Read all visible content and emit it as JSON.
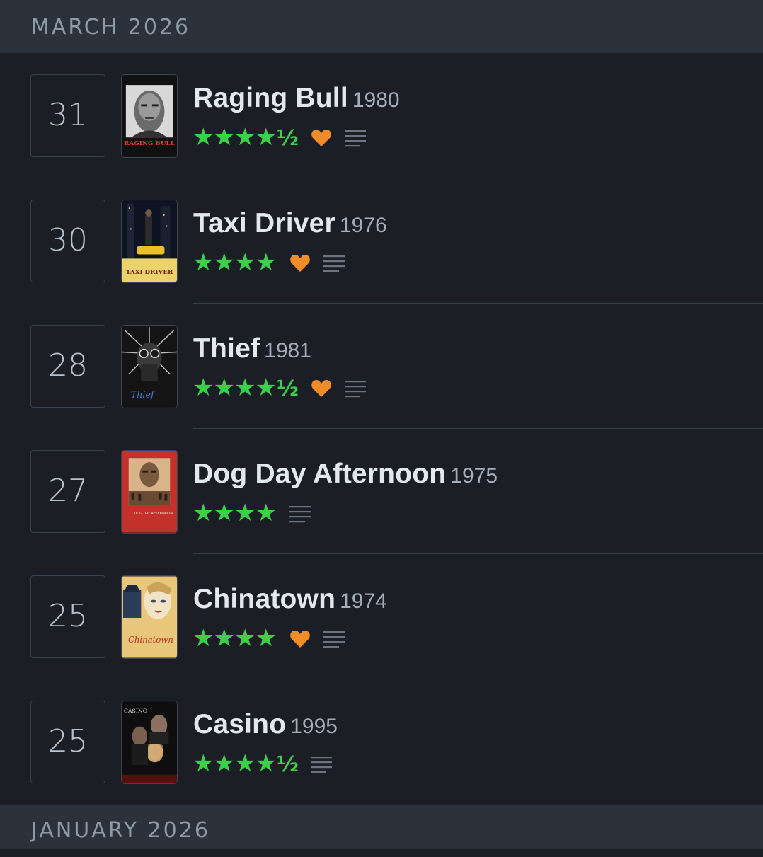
{
  "months": {
    "current": "MARCH 2026",
    "next": "JANUARY 2026"
  },
  "colors": {
    "background": "#1b1f25",
    "header": "#2b323b",
    "star_green": "#3ccf4a",
    "heart_orange": "#f28c28"
  },
  "entries": [
    {
      "day": "31",
      "title": "Raging Bull",
      "year": "1980",
      "stars": "★★★★",
      "half": "½",
      "rating": 4.5,
      "liked": true,
      "has_review": true,
      "poster_icon": "raging-bull-poster"
    },
    {
      "day": "30",
      "title": "Taxi Driver",
      "year": "1976",
      "stars": "★★★★",
      "half": "",
      "rating": 4,
      "liked": true,
      "has_review": true,
      "poster_icon": "taxi-driver-poster"
    },
    {
      "day": "28",
      "title": "Thief",
      "year": "1981",
      "stars": "★★★★",
      "half": "½",
      "rating": 4.5,
      "liked": true,
      "has_review": true,
      "poster_icon": "thief-poster"
    },
    {
      "day": "27",
      "title": "Dog Day Afternoon",
      "year": "1975",
      "stars": "★★★★",
      "half": "",
      "rating": 4,
      "liked": false,
      "has_review": true,
      "poster_icon": "dog-day-afternoon-poster"
    },
    {
      "day": "25",
      "title": "Chinatown",
      "year": "1974",
      "stars": "★★★★",
      "half": "",
      "rating": 4,
      "liked": true,
      "has_review": true,
      "poster_icon": "chinatown-poster"
    },
    {
      "day": "25",
      "title": "Casino",
      "year": "1995",
      "stars": "★★★★",
      "half": "½",
      "rating": 4.5,
      "liked": false,
      "has_review": true,
      "poster_icon": "casino-poster"
    }
  ],
  "poster_text": {
    "raging_bull": "RAGING BULL",
    "taxi_driver": "TAXI DRIVER",
    "thief": "Thief",
    "dog_day": "DOG DAY AFTERNOON",
    "chinatown": "Chinatown",
    "casino": "CASINO"
  }
}
